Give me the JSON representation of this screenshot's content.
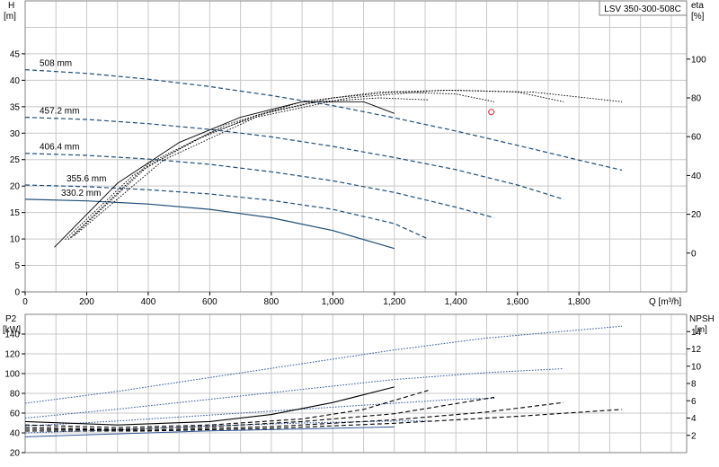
{
  "title": "LSV 350-300-508C",
  "colors": {
    "grid": "#c8c8c8",
    "frame": "#808080",
    "impeller_curve": "#1f4e79",
    "eta_curve": "#000000",
    "p2_curve": "#2f5597",
    "npsh_curve": "#000000",
    "duty_point": "#e02020"
  },
  "top": {
    "y_left_label_1": "H",
    "y_left_label_2": "[m]",
    "y_right_label_1": "eta",
    "y_right_label_2": "[%]",
    "x_label": "Q [m³/h]"
  },
  "bottom": {
    "y_left_label_1": "P2",
    "y_left_label_2": "[kW]",
    "y_right_label_1": "NPSH",
    "y_right_label_2": "[m]"
  },
  "chart_data": [
    {
      "type": "line",
      "panel": "head",
      "xlim": [
        0,
        2150
      ],
      "ylim": [
        0,
        55
      ],
      "y2lim": [
        -20,
        130
      ],
      "x_ticks": [
        0,
        200,
        400,
        600,
        800,
        1000,
        1200,
        1400,
        1600,
        1800
      ],
      "x_tick_labels": [
        "0",
        "200",
        "400",
        "600",
        "800",
        "1,000",
        "1,200",
        "1,400",
        "1,600",
        "1,800"
      ],
      "y_ticks": [
        0,
        5,
        10,
        15,
        20,
        25,
        30,
        35,
        40,
        45
      ],
      "y2_ticks": [
        0,
        20,
        40,
        60,
        80,
        100
      ],
      "series": [
        {
          "name": "508 mm",
          "style": "dashed",
          "x": [
            0,
            200,
            400,
            600,
            800,
            1000,
            1200,
            1400,
            1600,
            1800,
            1940
          ],
          "y": [
            42,
            41.3,
            40.2,
            38.8,
            37.1,
            35.2,
            32.9,
            30.4,
            27.7,
            24.9,
            23.0
          ]
        },
        {
          "name": "457.2 mm",
          "style": "dashed",
          "x": [
            0,
            200,
            400,
            600,
            800,
            1000,
            1200,
            1400,
            1600,
            1750
          ],
          "y": [
            33,
            32.6,
            31.8,
            30.7,
            29.3,
            27.5,
            25.4,
            23.1,
            20.2,
            17.5
          ]
        },
        {
          "name": "406.4 mm",
          "style": "dashed",
          "x": [
            0,
            200,
            400,
            600,
            800,
            1000,
            1200,
            1400,
            1525
          ],
          "y": [
            26.2,
            25.8,
            25.1,
            24.1,
            22.7,
            21.0,
            18.8,
            16.0,
            14.0
          ]
        },
        {
          "name": "355.6 mm",
          "style": "dashed",
          "x": [
            0,
            200,
            400,
            600,
            800,
            1000,
            1200,
            1310
          ],
          "y": [
            20.2,
            19.9,
            19.3,
            18.5,
            17.3,
            15.6,
            12.9,
            10.0
          ]
        },
        {
          "name": "330.2 mm",
          "style": "solid",
          "x": [
            0,
            200,
            400,
            600,
            800,
            1000,
            1200
          ],
          "y": [
            17.5,
            17.2,
            16.6,
            15.6,
            14.0,
            11.6,
            8.2
          ]
        },
        {
          "axis": "right",
          "style": "solid",
          "x": [
            95,
            300,
            500,
            700,
            900,
            1100,
            1200
          ],
          "y": [
            3,
            36,
            57,
            70,
            78,
            78,
            72
          ]
        },
        {
          "axis": "right",
          "style": "dotted",
          "x": [
            130,
            350,
            550,
            750,
            950,
            1150,
            1310
          ],
          "y": [
            7,
            40,
            58,
            71,
            78,
            80,
            79
          ]
        },
        {
          "axis": "right",
          "style": "dotted",
          "x": [
            140,
            400,
            600,
            800,
            1000,
            1200,
            1400,
            1525
          ],
          "y": [
            7,
            46,
            62,
            73,
            80,
            83,
            82,
            78
          ]
        },
        {
          "axis": "right",
          "style": "dotted",
          "x": [
            150,
            400,
            650,
            900,
            1150,
            1400,
            1600,
            1750
          ],
          "y": [
            8,
            45,
            66,
            78,
            83,
            84,
            83,
            78
          ]
        },
        {
          "axis": "right",
          "style": "dotted",
          "x": [
            160,
            450,
            750,
            1050,
            1350,
            1650,
            1940
          ],
          "y": [
            9,
            48,
            70,
            80,
            84,
            83,
            78
          ]
        }
      ],
      "duty_point": {
        "x": 1515,
        "y": 34
      }
    },
    {
      "type": "line",
      "panel": "power_npsh",
      "xlim": [
        0,
        2150
      ],
      "ylim": [
        20,
        160
      ],
      "y2lim": [
        0,
        16
      ],
      "y_ticks": [
        20,
        40,
        60,
        80,
        100,
        120,
        140
      ],
      "y2_ticks": [
        2,
        4,
        6,
        8,
        10,
        12,
        14
      ],
      "series": [
        {
          "style": "dotted",
          "x": [
            0,
            300,
            600,
            900,
            1200,
            1500,
            1940
          ],
          "y": [
            70,
            82,
            96,
            110,
            124,
            136,
            148
          ]
        },
        {
          "style": "dotted",
          "x": [
            0,
            300,
            600,
            900,
            1200,
            1500,
            1750
          ],
          "y": [
            55,
            64,
            74,
            84,
            94,
            101,
            105
          ]
        },
        {
          "style": "dotted",
          "x": [
            0,
            300,
            600,
            900,
            1200,
            1400,
            1525
          ],
          "y": [
            47,
            52,
            58,
            64,
            70,
            74,
            75
          ]
        },
        {
          "style": "dotted",
          "x": [
            0,
            300,
            600,
            900,
            1200,
            1310
          ],
          "y": [
            40,
            43,
            47,
            50,
            52,
            52
          ]
        },
        {
          "style": "solid",
          "x": [
            0,
            300,
            600,
            900,
            1200
          ],
          "y": [
            36,
            39,
            42,
            44,
            46
          ]
        },
        {
          "axis": "right",
          "style": "solid",
          "x": [
            0,
            300,
            600,
            800,
            1000,
            1200
          ],
          "y": [
            3.6,
            3.2,
            3.6,
            4.4,
            5.8,
            7.6
          ]
        },
        {
          "axis": "right",
          "style": "dashed",
          "x": [
            0,
            300,
            600,
            900,
            1100,
            1310
          ],
          "y": [
            3.2,
            2.9,
            3.2,
            3.9,
            5.0,
            7.2
          ]
        },
        {
          "axis": "right",
          "style": "dashed",
          "x": [
            0,
            300,
            600,
            900,
            1200,
            1525
          ],
          "y": [
            2.9,
            2.7,
            3.0,
            3.6,
            4.5,
            6.4
          ]
        },
        {
          "axis": "right",
          "style": "dashed",
          "x": [
            0,
            400,
            800,
            1200,
            1500,
            1750
          ],
          "y": [
            2.7,
            2.6,
            3.0,
            3.8,
            4.7,
            5.8
          ]
        },
        {
          "axis": "right",
          "style": "dashed",
          "x": [
            0,
            400,
            800,
            1200,
            1600,
            1940
          ],
          "y": [
            2.5,
            2.5,
            2.8,
            3.4,
            4.2,
            5.0
          ]
        }
      ]
    }
  ]
}
